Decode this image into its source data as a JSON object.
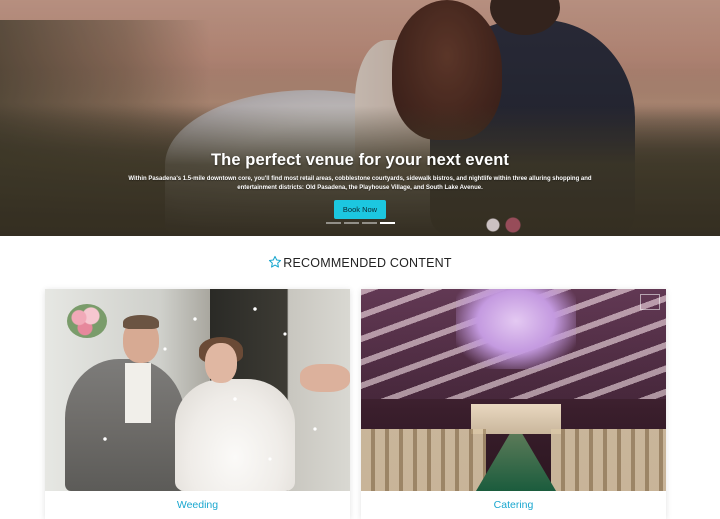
{
  "hero": {
    "title": "The perfect venue for your next event",
    "description": "Within Pasadena's 1.5-mile downtown core, you'll find most retail areas, cobblestone courtyards, sidewalk bistros, and nightlife within three alluring shopping and entertainment districts: Old Pasadena, the Playhouse Village, and South Lake Avenue.",
    "button_label": "Book Now",
    "slides": {
      "count": 4,
      "active_index": 3
    }
  },
  "section": {
    "icon": "star-icon",
    "title": "RECOMMENDED CONTENT"
  },
  "cards": [
    {
      "caption": "Weeding",
      "image": "wedding-couple-photo"
    },
    {
      "caption": "Catering",
      "image": "banquet-hall-photo"
    }
  ],
  "colors": {
    "accent": "#1cc7e0",
    "caption": "#1aa7cf",
    "star_outline": "#1aa7cf"
  }
}
